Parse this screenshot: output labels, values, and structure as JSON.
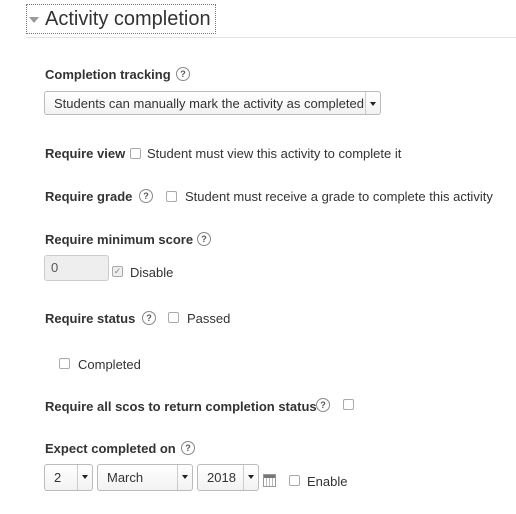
{
  "section": {
    "title": "Activity completion"
  },
  "completion_tracking": {
    "label": "Completion tracking",
    "value": "Students can manually mark the activity as completed"
  },
  "require_view": {
    "label": "Require view",
    "checkbox_label": "Student must view this activity to complete it",
    "checked": false
  },
  "require_grade": {
    "label": "Require grade",
    "checkbox_label": "Student must receive a grade to complete this activity",
    "checked": false
  },
  "require_min_score": {
    "label": "Require minimum score",
    "value": "0",
    "disable_label": "Disable",
    "disable_checked": true
  },
  "require_status": {
    "label": "Require status",
    "options": [
      {
        "label": "Passed",
        "checked": false
      },
      {
        "label": "Completed",
        "checked": false
      }
    ]
  },
  "require_all_scos": {
    "label": "Require all scos to return completion status",
    "checked": false
  },
  "expect_completed": {
    "label": "Expect completed on",
    "day": "2",
    "month": "March",
    "year": "2018",
    "enable_label": "Enable",
    "enable_checked": false
  },
  "help_glyph": "?",
  "check_glyph": "✓"
}
